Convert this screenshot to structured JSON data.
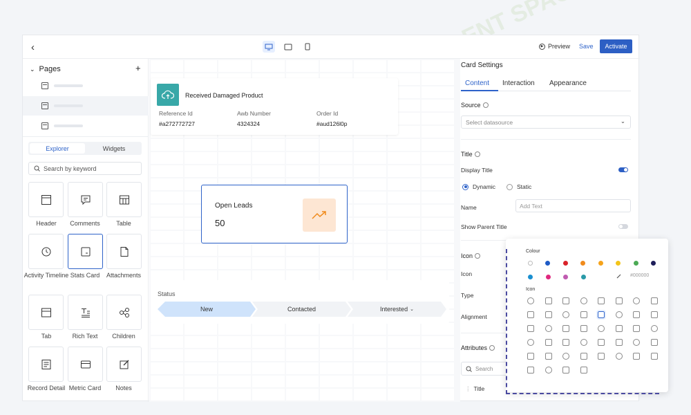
{
  "topbar": {
    "preview_label": "Preview",
    "save_label": "Save",
    "activate_label": "Activate"
  },
  "sidebar": {
    "pages_title": "Pages",
    "tabs": [
      "Explorer",
      "Widgets"
    ],
    "search_placeholder": "Search by keyword",
    "widgets": [
      {
        "label": "Header",
        "icon": "header-icon"
      },
      {
        "label": "Comments",
        "icon": "comments-icon"
      },
      {
        "label": "Table",
        "icon": "table-icon"
      },
      {
        "label": "Activity Timeline",
        "icon": "timeline-icon"
      },
      {
        "label": "Stats Card",
        "icon": "stats-card-icon"
      },
      {
        "label": "Attachments",
        "icon": "attachments-icon"
      },
      {
        "label": "Tab",
        "icon": "tab-icon"
      },
      {
        "label": "Rich Text",
        "icon": "rich-text-icon"
      },
      {
        "label": "Children",
        "icon": "children-icon"
      },
      {
        "label": "Record Detail",
        "icon": "record-detail-icon"
      },
      {
        "label": "Metric Card",
        "icon": "metric-card-icon"
      },
      {
        "label": "Notes",
        "icon": "notes-icon"
      }
    ]
  },
  "canvas": {
    "record_card": {
      "title": "Received Damaged Product",
      "fields": [
        {
          "label": "Reference Id",
          "value": "#a272772727"
        },
        {
          "label": "Awb Number",
          "value": "4324324"
        },
        {
          "label": "Order Id",
          "value": "#aud126l0p"
        }
      ]
    },
    "stats_card": {
      "title": "Open Leads",
      "value": "50"
    },
    "status_card": {
      "title": "Status",
      "steps": [
        "New",
        "Contacted",
        "Interested"
      ]
    }
  },
  "settings": {
    "title": "Card Settings",
    "tabs": [
      "Content",
      "Interaction",
      "Appearance"
    ],
    "source_label": "Source",
    "source_placeholder": "Select datasource",
    "title_section": "Title",
    "display_title_label": "Display Title",
    "display_title_on": true,
    "radio_options": [
      "Dynamic",
      "Static"
    ],
    "name_label": "Name",
    "name_placeholder": "Add Text",
    "show_parent_label": "Show Parent Title",
    "show_parent_on": false,
    "icon_section": "Icon",
    "icon_label": "Icon",
    "type_label": "Type",
    "alignment_label": "Alignment",
    "attributes_label": "Attributes",
    "attr_search_placeholder": "Search",
    "attr_first": "Title"
  },
  "picker": {
    "colour_label": "Colour",
    "icon_label": "Icon",
    "hex_placeholder": "#000000",
    "colors_row1": [
      "#1e5bc6",
      "#d9232a",
      "#f08b1d",
      "#f5a31b",
      "#f3c51a",
      "#4caa55",
      "#1e1e5a"
    ],
    "colors_row2": [
      "#1a8fd0",
      "#e0287e",
      "#c05bb0",
      "#2a9aa8"
    ]
  },
  "colors": {
    "accent": "#2d62c9",
    "teal": "#38a8a8",
    "orange_bg": "#fde6d3"
  },
  "watermark": "AI TALENT SPACE"
}
